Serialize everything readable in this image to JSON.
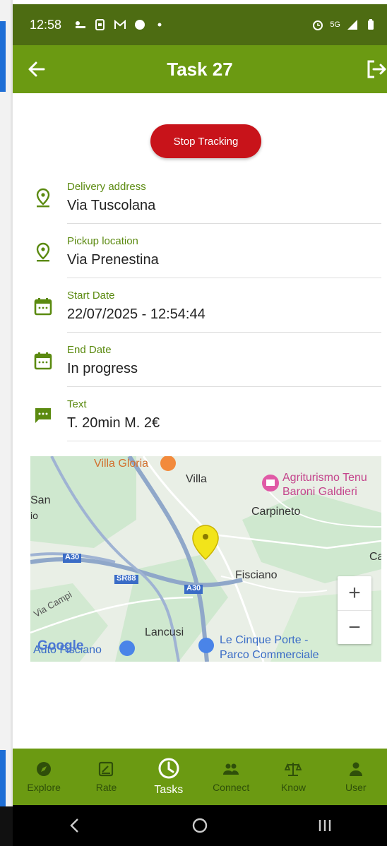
{
  "status_bar": {
    "time": "12:58",
    "network": "5G"
  },
  "app_bar": {
    "title": "Task 27"
  },
  "stop_button_label": "Stop Tracking",
  "info_rows": [
    {
      "label": "Delivery address",
      "value": "Via Tuscolana",
      "icon": "location-pin-icon"
    },
    {
      "label": "Pickup location",
      "value": "Via Prenestina",
      "icon": "location-pin-icon"
    },
    {
      "label": "Start Date",
      "value": "22/07/2025 - 12:54:44",
      "icon": "calendar-icon"
    },
    {
      "label": "End Date",
      "value": "In progress",
      "icon": "calendar-icon"
    },
    {
      "label": "Text",
      "value": "T. 20min M. 2€",
      "icon": "chat-icon"
    }
  ],
  "map": {
    "labels": {
      "villa_gloria": "Villa Gloria",
      "villa": "Villa",
      "agriturismo_1": "Agriturismo Tenu",
      "agriturismo_2": "Baroni Galdieri",
      "san": "San",
      "io": "io",
      "carpineto": "Carpineto",
      "ca": "Ca",
      "fisciano": "Fisciano",
      "a30_1": "A30",
      "a30_2": "A30",
      "sr88": "SR88",
      "via_campi": "Via Campi",
      "lancusi": "Lancusi",
      "auto_fisciano": "Auto Fisciano",
      "le_cinque_porte_1": "Le Cinque Porte -",
      "le_cinque_porte_2": "Parco Commerciale",
      "google": "Google"
    },
    "zoom_in": "+",
    "zoom_out": "−",
    "colors": {
      "land": "#e8efe6",
      "green": "#cfe8cf",
      "highway": "#8fa7c9",
      "marker": "#f2e41a"
    }
  },
  "bottom_nav": [
    {
      "label": "Explore",
      "icon": "compass-icon",
      "active": false
    },
    {
      "label": "Rate",
      "icon": "rate-icon",
      "active": false
    },
    {
      "label": "Tasks",
      "icon": "clock-icon",
      "active": true
    },
    {
      "label": "Connect",
      "icon": "people-icon",
      "active": false
    },
    {
      "label": "Know",
      "icon": "scales-icon",
      "active": false
    },
    {
      "label": "User",
      "icon": "person-icon",
      "active": false
    }
  ],
  "colors": {
    "primary": "#6b9a12",
    "status_bar": "#4d6c12",
    "stop": "#c8131a",
    "label_green": "#5b8a10"
  }
}
